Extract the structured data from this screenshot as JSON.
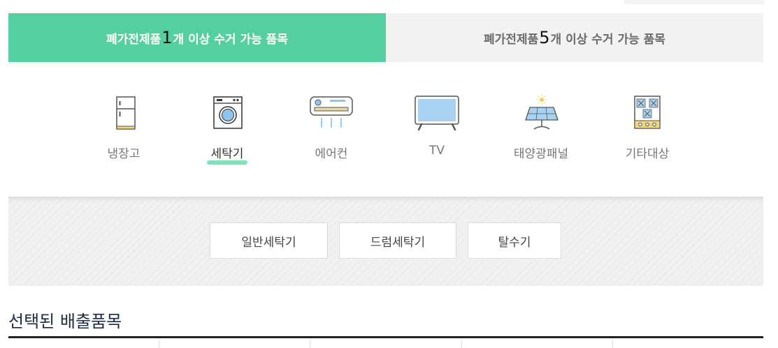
{
  "tabs": [
    {
      "prefix": "폐가전제품 ",
      "num": "1",
      "suffix": "개 이상 수거 가능 품목",
      "active": true
    },
    {
      "prefix": "폐가전제품 ",
      "num": "5",
      "suffix": "개 이상 수거 가능 품목",
      "active": false
    }
  ],
  "categories": [
    {
      "label": "냉장고",
      "icon": "refrigerator-icon"
    },
    {
      "label": "세탁기",
      "icon": "washing-machine-icon",
      "active": true
    },
    {
      "label": "에어컨",
      "icon": "air-conditioner-icon"
    },
    {
      "label": "TV",
      "icon": "tv-icon"
    },
    {
      "label": "태양광패널",
      "icon": "solar-panel-icon"
    },
    {
      "label": "기타대상",
      "icon": "gas-stove-icon"
    }
  ],
  "subcategories": [
    "일반세탁기",
    "드럼세탁기",
    "탈수기"
  ],
  "selected": {
    "title": "선택된 배출품목"
  },
  "colors": {
    "accent": "#55cf9f",
    "highlight": "#7fe3b9",
    "inactive_tab": "#f2f2f2"
  }
}
